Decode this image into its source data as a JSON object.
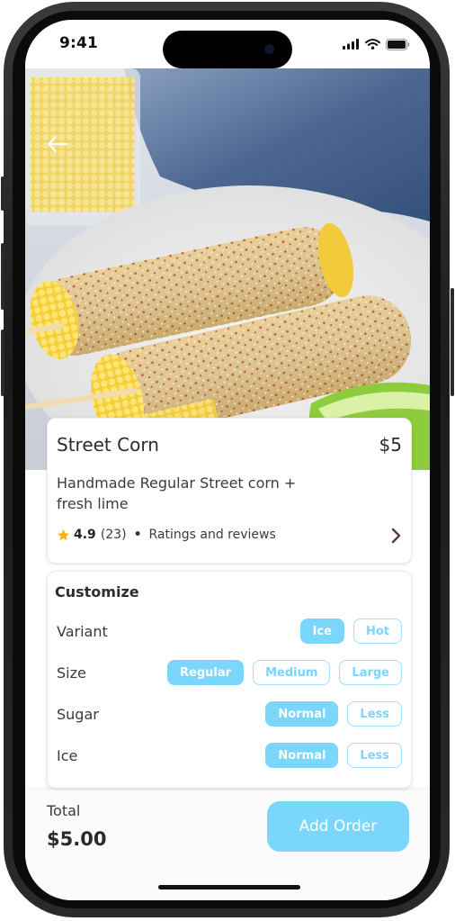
{
  "status_bar": {
    "time": "9:41",
    "icons": [
      "signal-icon",
      "wifi-icon",
      "battery-icon"
    ]
  },
  "hero": {
    "image": "street-corn-photo",
    "back_icon": "arrow-left-icon"
  },
  "product": {
    "name": "Street Corn",
    "price": "$5",
    "description": "Handmade Regular Street corn + fresh lime",
    "rating": "4.9",
    "rating_count": "(23)",
    "separator": "•",
    "reviews_label": "Ratings and reviews"
  },
  "customize": {
    "title": "Customize",
    "options": [
      {
        "label": "Variant",
        "choices": [
          "Ice",
          "Hot"
        ],
        "selected": "Ice"
      },
      {
        "label": "Size",
        "choices": [
          "Regular",
          "Medium",
          "Large"
        ],
        "selected": "Regular"
      },
      {
        "label": "Sugar",
        "choices": [
          "Normal",
          "Less"
        ],
        "selected": "Normal"
      },
      {
        "label": "Ice",
        "choices": [
          "Normal",
          "Less"
        ],
        "selected": "Normal"
      }
    ]
  },
  "footer": {
    "total_label": "Total",
    "total_value": "$5.00",
    "button_label": "Add Order"
  },
  "colors": {
    "accent": "#7ad6fb",
    "star": "#f5b301",
    "text": "#2c2c2c"
  }
}
